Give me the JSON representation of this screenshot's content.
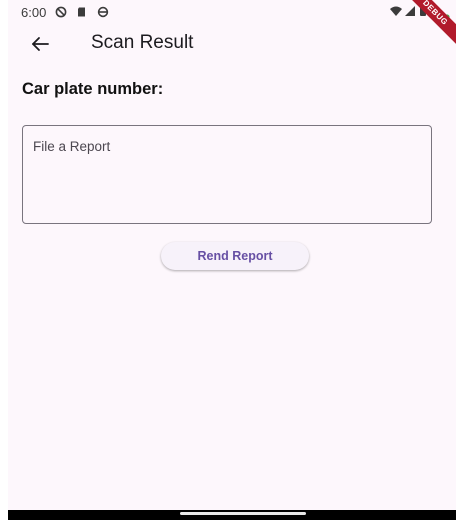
{
  "status_bar": {
    "time": "6:00",
    "icons": [
      "do-not-disturb-icon",
      "sd-card-icon",
      "sync-icon",
      "wifi-icon",
      "signal-icon",
      "battery-icon"
    ],
    "debug_label": "DEBUG"
  },
  "app_bar": {
    "back_icon": "arrow-left-icon",
    "title": "Scan Result"
  },
  "main": {
    "plate_label": "Car plate number:",
    "report_field": {
      "placeholder": "File a Report",
      "value": ""
    },
    "send_button_label": "Rend Report"
  },
  "colors": {
    "background": "#fdf7fc",
    "accent": "#6750a4",
    "outline": "#79747e",
    "debug_banner": "#b11a2b"
  }
}
